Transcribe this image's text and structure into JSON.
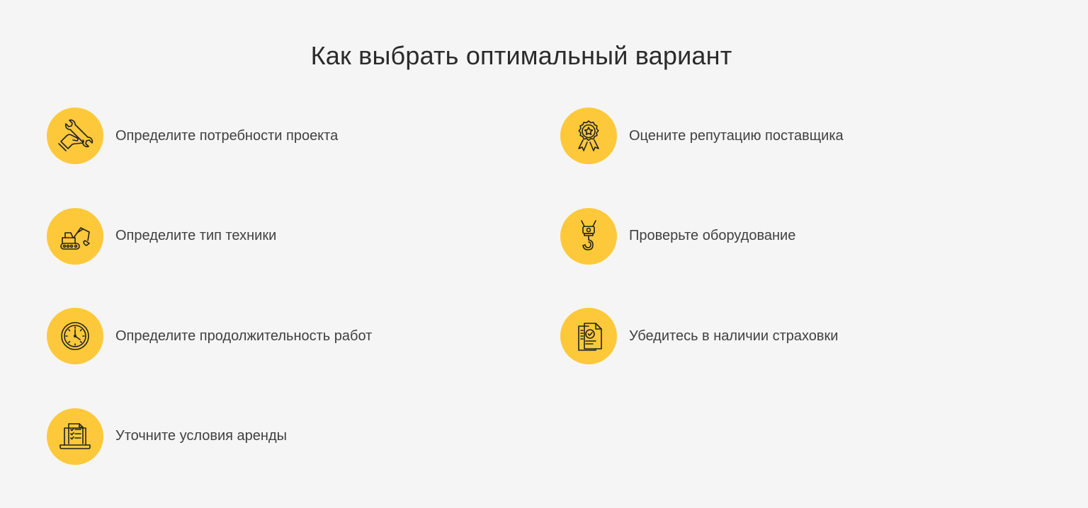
{
  "title": "Как выбрать оптимальный вариант",
  "colors": {
    "background": "#f5f5f5",
    "icon_circle": "#fdc93a",
    "text": "#404040"
  },
  "left_items": [
    {
      "label": "Определите потребности проекта",
      "icon": "hand-wrench-icon"
    },
    {
      "label": "Определите тип техники",
      "icon": "excavator-icon"
    },
    {
      "label": "Определите продолжительность работ",
      "icon": "clock-icon"
    },
    {
      "label": "Уточните условия аренды",
      "icon": "laptop-document-icon"
    }
  ],
  "right_items": [
    {
      "label": "Оцените репутацию поставщика",
      "icon": "award-medal-icon"
    },
    {
      "label": "Проверьте оборудование",
      "icon": "crane-hook-icon"
    },
    {
      "label": "Убедитесь в наличии страховки",
      "icon": "certificate-check-icon"
    }
  ]
}
